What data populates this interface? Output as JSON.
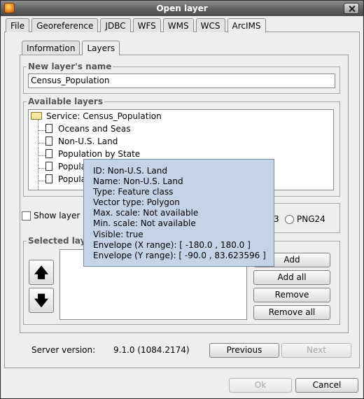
{
  "window": {
    "title": "Open layer"
  },
  "outer_tabs": [
    "File",
    "Georeference",
    "JDBC",
    "WFS",
    "WMS",
    "WCS",
    "ArcIMS"
  ],
  "inner_tabs": [
    "Information",
    "Layers"
  ],
  "new_layer": {
    "legend": "New layer's name",
    "value": "Census_Population"
  },
  "available_layers": {
    "legend": "Available layers",
    "root": "Service: Census_Population",
    "items": [
      "Oceans and Seas",
      "Non-U.S. Land",
      "Population by State",
      "Popula",
      "Popula"
    ]
  },
  "show_layer_ids": {
    "label": "Show layer II"
  },
  "image_format": {
    "visible_option": "PNG24",
    "left_fragment": "3"
  },
  "selected_layers": {
    "legend": "Selected laye",
    "buttons": {
      "add": "Add",
      "add_all": "Add all",
      "remove": "Remove",
      "remove_all": "Remove all"
    },
    "move_up_glyph": "🡅",
    "move_down_glyph": "🡇"
  },
  "tooltip": {
    "lines": [
      "ID: Non-U.S. Land",
      "Name: Non-U.S. Land",
      "Type: Feature class",
      "Vector type: Polygon",
      "Max. scale: Not available",
      "Min. scale: Not available",
      "Visible: true",
      "Envelope (X range): [ -180.0 , 180.0 ]",
      "Envelope (Y range): [ -90.0 , 83.623596 ]"
    ]
  },
  "server": {
    "label": "Server version:",
    "value": "9.1.0 (1084.2174)"
  },
  "nav": {
    "previous": "Previous",
    "next": "Next"
  },
  "footer": {
    "ok": "Ok",
    "cancel": "Cancel"
  }
}
